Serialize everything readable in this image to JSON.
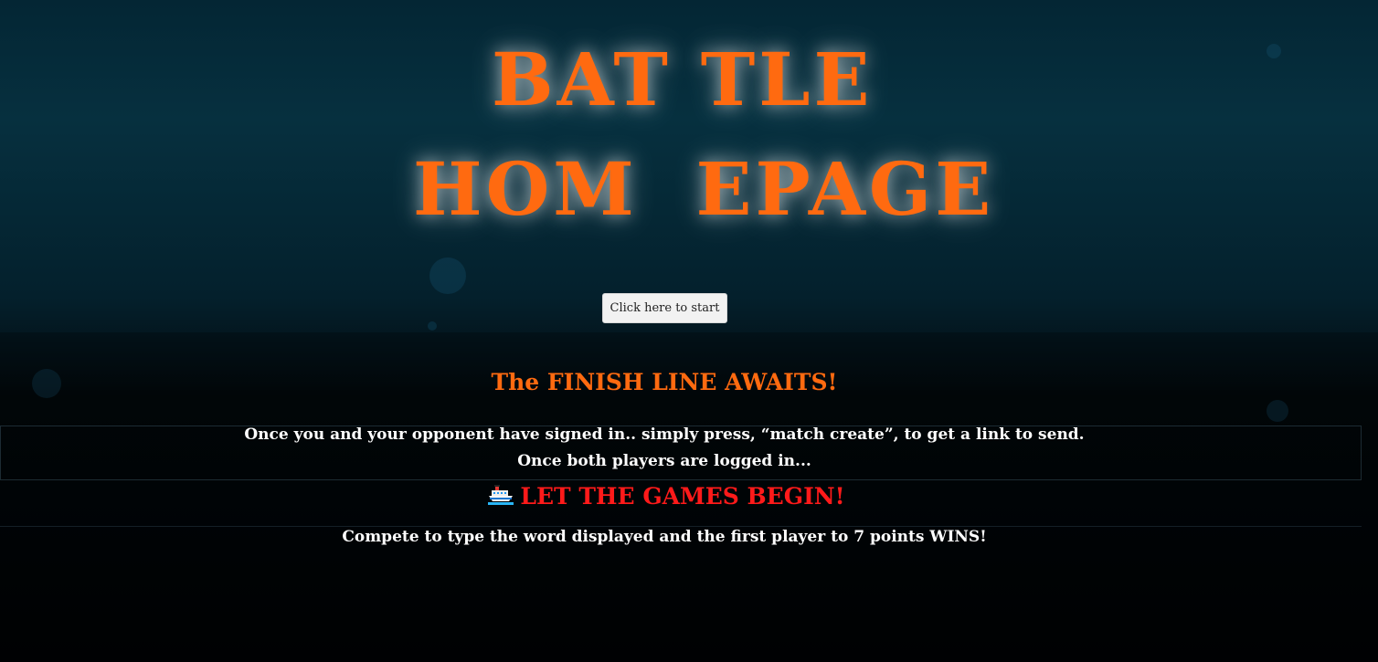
{
  "hero": {
    "title_line_1": "BAT TLE",
    "title_line_2": "HOM  EPAGE",
    "start_button_label": "Click here to start"
  },
  "info": {
    "heading": "The FINISH LINE AWAITS!",
    "line_1": "Once you and your opponent have signed in.. simply press, “match create”, to get a link to send.",
    "line_2": "Once both players are logged in...",
    "games_icon": "ship-icon",
    "games_begin": "LET THE GAMES BEGIN!",
    "line_3": "Compete to type the word displayed and the first player to 7 points WINS!"
  },
  "colors": {
    "title": "#ff6a10",
    "games_begin": "#ff1a1a",
    "text": "#ffffff",
    "background_top": "#06303f",
    "background_bottom": "#000204"
  }
}
